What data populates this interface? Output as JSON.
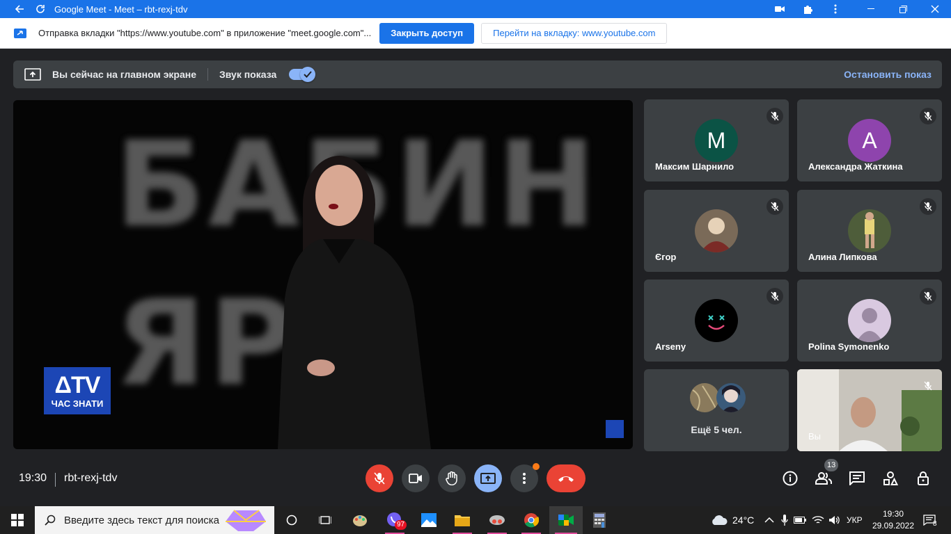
{
  "window": {
    "title": "Google Meet - Meet – rbt-rexj-tdv"
  },
  "infobar": {
    "message": "Отправка вкладки \"https://www.youtube.com\" в приложение \"meet.google.com\"...",
    "stop_sharing": "Закрыть доступ",
    "switch_tab": "Перейти на вкладку: www.youtube.com"
  },
  "present_bar": {
    "status": "Вы сейчас на главном экране",
    "audio_label": "Звук показа",
    "audio_on": true,
    "stop_label": "Остановить показ"
  },
  "main_video": {
    "bg_word_1": "БАБИН",
    "bg_word_2": "ЯР",
    "logo_top": "ΔTV",
    "logo_bottom": "ЧАС ЗНАТИ"
  },
  "participants": [
    {
      "name": "Максим Шарнило",
      "initial": "M",
      "avatar_color": "#0b5345",
      "muted": true
    },
    {
      "name": "Александра Жаткина",
      "initial": "A",
      "avatar_color": "#8e44ad",
      "muted": true
    },
    {
      "name": "Єгор",
      "initial": "",
      "avatar_color": "#7a6a58",
      "muted": true
    },
    {
      "name": "Алина Липкова",
      "initial": "",
      "avatar_color": "#4e5d3a",
      "muted": true
    },
    {
      "name": "Arseny",
      "initial": "",
      "avatar_color": "#000000",
      "muted": true
    },
    {
      "name": "Polina Symonenko",
      "initial": "",
      "avatar_color": "#d9c9e0",
      "muted": true
    }
  ],
  "more": {
    "label": "Ещё 5 чел."
  },
  "self_tile": {
    "label": "Вы"
  },
  "bottom_bar": {
    "time": "19:30",
    "meeting_code": "rbt-rexj-tdv",
    "participants_count": "13"
  },
  "taskbar": {
    "search_placeholder": "Введите здесь текст для поиска",
    "weather": "24°C",
    "lang": "УКР",
    "clock_time": "19:30",
    "clock_date": "29.09.2022",
    "viber_badge": "97",
    "notif_count": "8"
  }
}
